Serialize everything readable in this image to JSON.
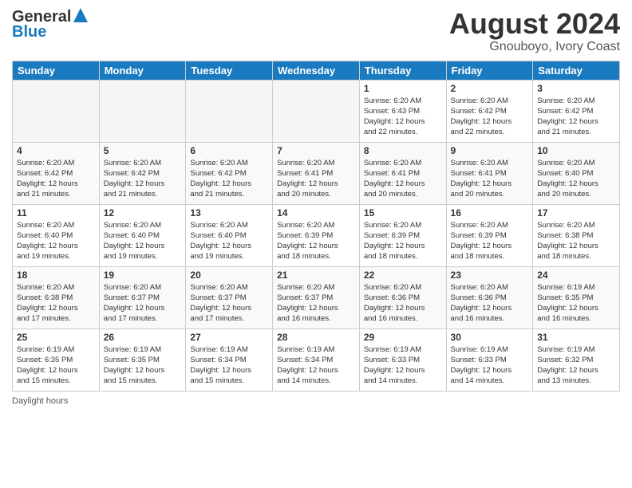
{
  "header": {
    "logo_line1": "General",
    "logo_line2": "Blue",
    "title": "August 2024",
    "subtitle": "Gnouboyo, Ivory Coast"
  },
  "days_of_week": [
    "Sunday",
    "Monday",
    "Tuesday",
    "Wednesday",
    "Thursday",
    "Friday",
    "Saturday"
  ],
  "weeks": [
    [
      {
        "day": "",
        "empty": true
      },
      {
        "day": "",
        "empty": true
      },
      {
        "day": "",
        "empty": true
      },
      {
        "day": "",
        "empty": true
      },
      {
        "day": "1",
        "info": "Sunrise: 6:20 AM\nSunset: 6:43 PM\nDaylight: 12 hours\nand 22 minutes."
      },
      {
        "day": "2",
        "info": "Sunrise: 6:20 AM\nSunset: 6:42 PM\nDaylight: 12 hours\nand 22 minutes."
      },
      {
        "day": "3",
        "info": "Sunrise: 6:20 AM\nSunset: 6:42 PM\nDaylight: 12 hours\nand 21 minutes."
      }
    ],
    [
      {
        "day": "4",
        "info": "Sunrise: 6:20 AM\nSunset: 6:42 PM\nDaylight: 12 hours\nand 21 minutes."
      },
      {
        "day": "5",
        "info": "Sunrise: 6:20 AM\nSunset: 6:42 PM\nDaylight: 12 hours\nand 21 minutes."
      },
      {
        "day": "6",
        "info": "Sunrise: 6:20 AM\nSunset: 6:42 PM\nDaylight: 12 hours\nand 21 minutes."
      },
      {
        "day": "7",
        "info": "Sunrise: 6:20 AM\nSunset: 6:41 PM\nDaylight: 12 hours\nand 20 minutes."
      },
      {
        "day": "8",
        "info": "Sunrise: 6:20 AM\nSunset: 6:41 PM\nDaylight: 12 hours\nand 20 minutes."
      },
      {
        "day": "9",
        "info": "Sunrise: 6:20 AM\nSunset: 6:41 PM\nDaylight: 12 hours\nand 20 minutes."
      },
      {
        "day": "10",
        "info": "Sunrise: 6:20 AM\nSunset: 6:40 PM\nDaylight: 12 hours\nand 20 minutes."
      }
    ],
    [
      {
        "day": "11",
        "info": "Sunrise: 6:20 AM\nSunset: 6:40 PM\nDaylight: 12 hours\nand 19 minutes."
      },
      {
        "day": "12",
        "info": "Sunrise: 6:20 AM\nSunset: 6:40 PM\nDaylight: 12 hours\nand 19 minutes."
      },
      {
        "day": "13",
        "info": "Sunrise: 6:20 AM\nSunset: 6:40 PM\nDaylight: 12 hours\nand 19 minutes."
      },
      {
        "day": "14",
        "info": "Sunrise: 6:20 AM\nSunset: 6:39 PM\nDaylight: 12 hours\nand 18 minutes."
      },
      {
        "day": "15",
        "info": "Sunrise: 6:20 AM\nSunset: 6:39 PM\nDaylight: 12 hours\nand 18 minutes."
      },
      {
        "day": "16",
        "info": "Sunrise: 6:20 AM\nSunset: 6:39 PM\nDaylight: 12 hours\nand 18 minutes."
      },
      {
        "day": "17",
        "info": "Sunrise: 6:20 AM\nSunset: 6:38 PM\nDaylight: 12 hours\nand 18 minutes."
      }
    ],
    [
      {
        "day": "18",
        "info": "Sunrise: 6:20 AM\nSunset: 6:38 PM\nDaylight: 12 hours\nand 17 minutes."
      },
      {
        "day": "19",
        "info": "Sunrise: 6:20 AM\nSunset: 6:37 PM\nDaylight: 12 hours\nand 17 minutes."
      },
      {
        "day": "20",
        "info": "Sunrise: 6:20 AM\nSunset: 6:37 PM\nDaylight: 12 hours\nand 17 minutes."
      },
      {
        "day": "21",
        "info": "Sunrise: 6:20 AM\nSunset: 6:37 PM\nDaylight: 12 hours\nand 16 minutes."
      },
      {
        "day": "22",
        "info": "Sunrise: 6:20 AM\nSunset: 6:36 PM\nDaylight: 12 hours\nand 16 minutes."
      },
      {
        "day": "23",
        "info": "Sunrise: 6:20 AM\nSunset: 6:36 PM\nDaylight: 12 hours\nand 16 minutes."
      },
      {
        "day": "24",
        "info": "Sunrise: 6:19 AM\nSunset: 6:35 PM\nDaylight: 12 hours\nand 16 minutes."
      }
    ],
    [
      {
        "day": "25",
        "info": "Sunrise: 6:19 AM\nSunset: 6:35 PM\nDaylight: 12 hours\nand 15 minutes."
      },
      {
        "day": "26",
        "info": "Sunrise: 6:19 AM\nSunset: 6:35 PM\nDaylight: 12 hours\nand 15 minutes."
      },
      {
        "day": "27",
        "info": "Sunrise: 6:19 AM\nSunset: 6:34 PM\nDaylight: 12 hours\nand 15 minutes."
      },
      {
        "day": "28",
        "info": "Sunrise: 6:19 AM\nSunset: 6:34 PM\nDaylight: 12 hours\nand 14 minutes."
      },
      {
        "day": "29",
        "info": "Sunrise: 6:19 AM\nSunset: 6:33 PM\nDaylight: 12 hours\nand 14 minutes."
      },
      {
        "day": "30",
        "info": "Sunrise: 6:19 AM\nSunset: 6:33 PM\nDaylight: 12 hours\nand 14 minutes."
      },
      {
        "day": "31",
        "info": "Sunrise: 6:19 AM\nSunset: 6:32 PM\nDaylight: 12 hours\nand 13 minutes."
      }
    ]
  ],
  "footer": {
    "text": "Daylight hours"
  }
}
